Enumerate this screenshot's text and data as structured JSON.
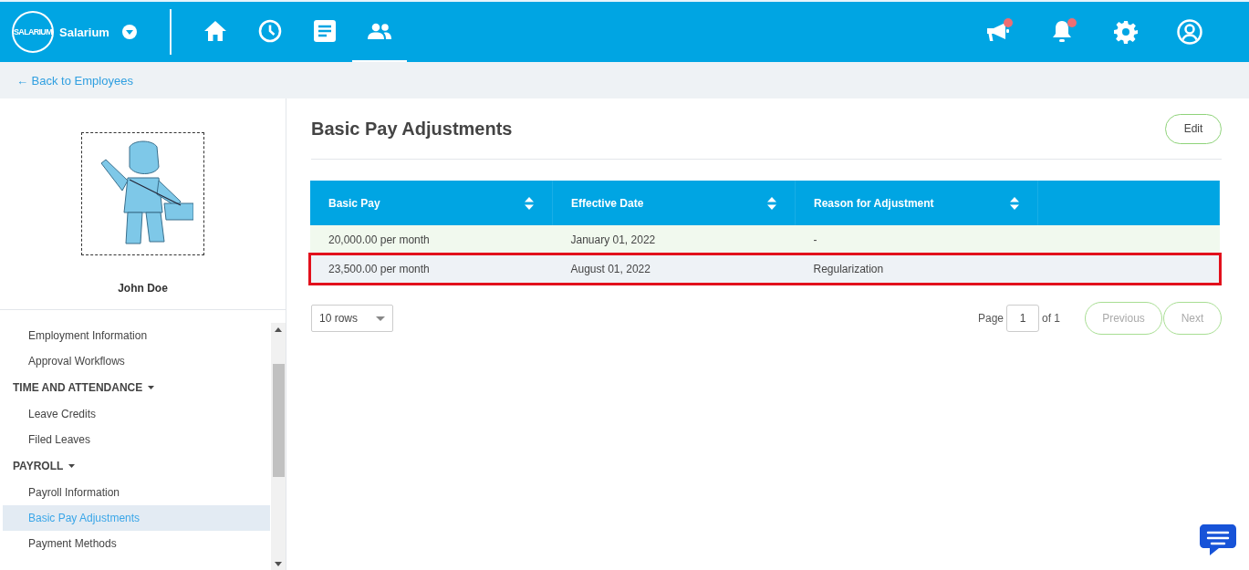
{
  "topbar": {
    "logo_text": "SALARIUM",
    "company": "Salarium",
    "nav": [
      {
        "kind": "home",
        "selected": false
      },
      {
        "kind": "clock",
        "selected": false
      },
      {
        "kind": "document",
        "selected": false
      },
      {
        "kind": "people",
        "selected": true
      }
    ],
    "actions": [
      {
        "kind": "megaphone",
        "badge": true
      },
      {
        "kind": "bell",
        "badge": true
      },
      {
        "kind": "settings",
        "badge": false
      },
      {
        "kind": "user",
        "badge": false
      }
    ]
  },
  "back_link": "← Back to Employees",
  "profile": {
    "name": "John Doe"
  },
  "sidebar": {
    "items": [
      {
        "kind": "item",
        "label": "Employment Information",
        "selected": false
      },
      {
        "kind": "item",
        "label": "Approval Workflows",
        "selected": false
      },
      {
        "kind": "section",
        "label": "TIME AND ATTENDANCE",
        "expanded": true
      },
      {
        "kind": "item",
        "label": "Leave Credits",
        "selected": false
      },
      {
        "kind": "item",
        "label": "Filed Leaves",
        "selected": false
      },
      {
        "kind": "section",
        "label": "PAYROLL",
        "expanded": true
      },
      {
        "kind": "item",
        "label": "Payroll Information",
        "selected": false
      },
      {
        "kind": "item",
        "label": "Basic Pay Adjustments",
        "selected": true
      },
      {
        "kind": "item",
        "label": "Payment Methods",
        "selected": false
      }
    ]
  },
  "page": {
    "title": "Basic Pay Adjustments",
    "edit_button": "Edit"
  },
  "table": {
    "columns": [
      "Basic Pay",
      "Effective Date",
      "Reason for Adjustment"
    ],
    "rows": [
      {
        "cells": [
          "20,000.00 per month",
          "January 01, 2022",
          "-"
        ],
        "highlighted": false
      },
      {
        "cells": [
          "23,500.00 per month",
          "August 01, 2022",
          "Regularization"
        ],
        "highlighted": true
      }
    ]
  },
  "pagination": {
    "rows_per_page": "10 rows",
    "page_label": "Page",
    "page": "1",
    "of_label": "of 1",
    "previous": "Previous",
    "next": "Next"
  }
}
